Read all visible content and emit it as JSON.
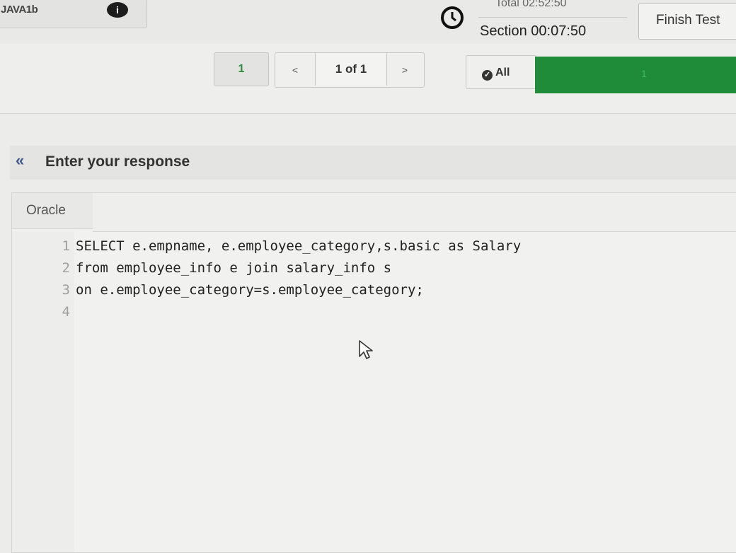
{
  "header": {
    "test_name": "JAVA1b",
    "info_icon": "info-icon",
    "timer_total": "Total 02:52:50",
    "timer_section": "Section 00:07:50",
    "finish_label": "Finish Test"
  },
  "nav": {
    "question_number": "1",
    "prev_label": "<",
    "page_count": "1 of 1",
    "next_label": ">",
    "filter_label": "All",
    "progress_label": "1",
    "progress_color": "#1f8c3a"
  },
  "response": {
    "title": "Enter your response",
    "collapse_icon": "double-chevron-left-icon"
  },
  "editor": {
    "language": "Oracle",
    "lines": [
      {
        "number": "1",
        "text": "SELECT e.empname, e.employee_category,s.basic as Salary"
      },
      {
        "number": "2",
        "text": "from employee_info e join salary_info s"
      },
      {
        "number": "3",
        "text": "on e.employee_category=s.employee_category;"
      },
      {
        "number": "4",
        "text": ""
      }
    ]
  }
}
